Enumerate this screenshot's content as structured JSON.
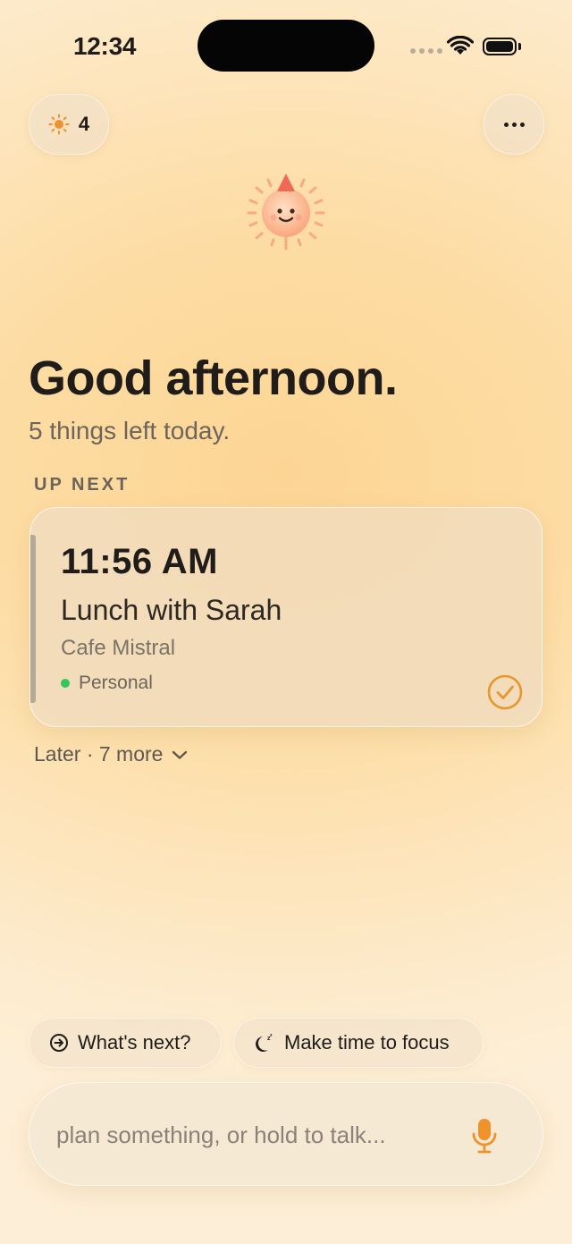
{
  "status_bar": {
    "time": "12:34"
  },
  "header": {
    "sun_count": "4"
  },
  "greeting": {
    "title": "Good afternoon.",
    "subtitle": "5 things left today."
  },
  "up_next": {
    "label": "UP NEXT",
    "event": {
      "time": "11:56 AM",
      "title": "Lunch with Sarah",
      "location": "Cafe Mistral",
      "tag": "Personal",
      "tag_color": "#34c759"
    }
  },
  "later": {
    "label": "Later · 7 more"
  },
  "suggestions": [
    {
      "label": "What's next?",
      "icon": "arrow-circle-icon"
    },
    {
      "label": "Make time to focus",
      "icon": "moon-sleep-icon"
    }
  ],
  "prompt": {
    "placeholder": "plan something, or hold to talk..."
  },
  "colors": {
    "accent": "#f0922b",
    "check": "#e8962e",
    "text": "#1f1c19"
  }
}
